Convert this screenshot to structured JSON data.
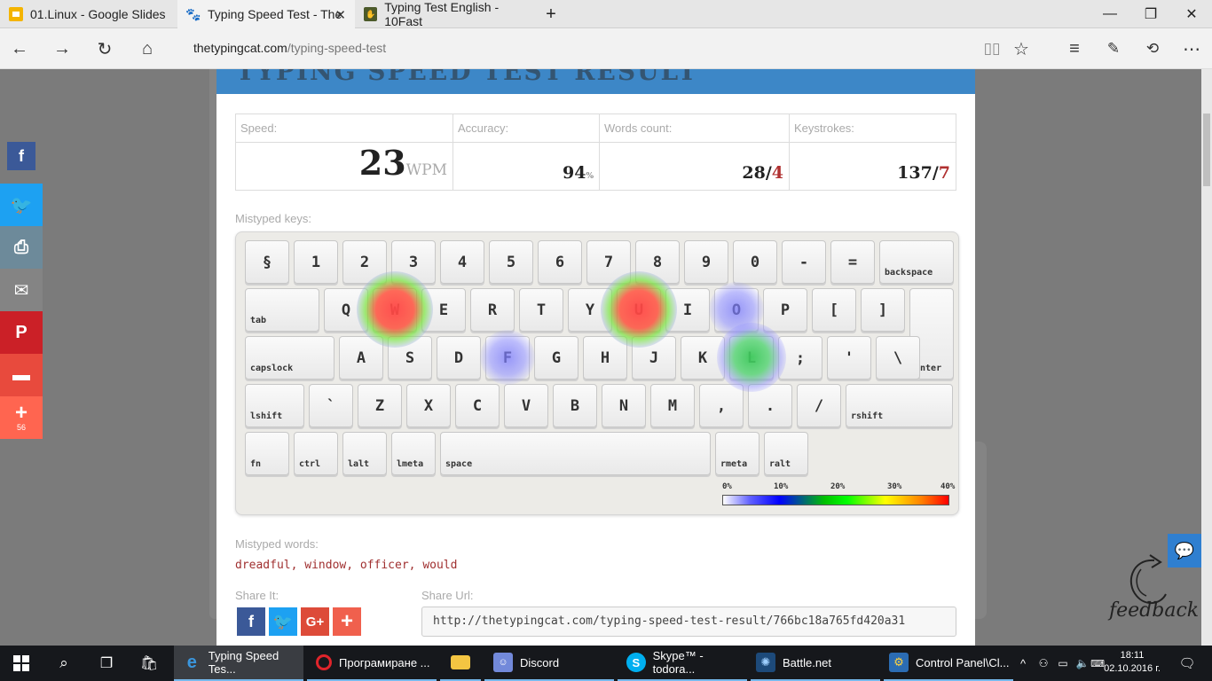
{
  "tabs": [
    {
      "title": "01.Linux - Google Slides",
      "icon": "google-slides-icon"
    },
    {
      "title": "Typing Speed Test - The",
      "icon": "paw-icon"
    },
    {
      "title": "Typing Test English - 10Fast",
      "icon": "tenfast-icon"
    }
  ],
  "address": {
    "domain": "thetypingcat.com",
    "path": "/typing-speed-test"
  },
  "page": {
    "heading": "TYPING SPEED TEST RESULT",
    "stats": {
      "speed_label": "Speed:",
      "speed_value": "23",
      "speed_unit": "WPM",
      "accuracy_label": "Accuracy:",
      "accuracy_value": "94",
      "accuracy_unit": "%",
      "words_label": "Words count:",
      "words_value": "28/",
      "words_errors": "4",
      "keys_label": "Keystrokes:",
      "keys_value": "137/",
      "keys_errors": "7"
    },
    "mistyped_keys_label": "Mistyped keys:",
    "keyboard_rows": [
      [
        "§",
        "1",
        "2",
        "3",
        "4",
        "5",
        "6",
        "7",
        "8",
        "9",
        "0",
        "-",
        "=",
        "backspace"
      ],
      [
        "tab",
        "Q",
        "W",
        "E",
        "R",
        "T",
        "Y",
        "U",
        "I",
        "O",
        "P",
        "[",
        "]",
        "enter"
      ],
      [
        "capslock",
        "A",
        "S",
        "D",
        "F",
        "G",
        "H",
        "J",
        "K",
        "L",
        ";",
        "'",
        "\\"
      ],
      [
        "lshift",
        "`",
        "Z",
        "X",
        "C",
        "V",
        "B",
        "N",
        "M",
        ",",
        ".",
        "/",
        "rshift"
      ],
      [
        "fn",
        "ctrl",
        "lalt",
        "lmeta",
        "space",
        "rmeta",
        "ralt"
      ]
    ],
    "mistyped_keys": [
      {
        "key": "W",
        "error_pct": 38
      },
      {
        "key": "U",
        "error_pct": 38
      },
      {
        "key": "L",
        "error_pct": 18
      },
      {
        "key": "O",
        "error_pct": 8
      },
      {
        "key": "F",
        "error_pct": 8
      }
    ],
    "scale_ticks": [
      "0%",
      "10%",
      "20%",
      "30%",
      "40%"
    ],
    "mistyped_words_label": "Mistyped words:",
    "mistyped_words": "dreadful, window, officer, would",
    "share_it_label": "Share It:",
    "share_url_label": "Share Url:",
    "share_url": "http://thetypingcat.com/typing-speed-test-result/766bc18a765fd420a31"
  },
  "sidebar": {
    "share_count": "56"
  },
  "feedback_text": "feedback",
  "taskbar": {
    "apps": [
      {
        "label": "Typing Speed Tes...",
        "icon": "edge-icon"
      },
      {
        "label": "Програмиране ...",
        "icon": "opera-icon"
      },
      {
        "label": "",
        "icon": "file-explorer-icon"
      },
      {
        "label": "Discord",
        "icon": "discord-icon"
      },
      {
        "label": "Skype™ - todora...",
        "icon": "skype-icon"
      },
      {
        "label": "Battle.net",
        "icon": "battlenet-icon"
      },
      {
        "label": "Control Panel\\Cl...",
        "icon": "control-panel-icon"
      }
    ],
    "time": "18:11",
    "date": "02.10.2016 г."
  },
  "colors": {
    "accent": "#3d87c7",
    "error": "#a03030",
    "taskbar": "#16181c"
  }
}
